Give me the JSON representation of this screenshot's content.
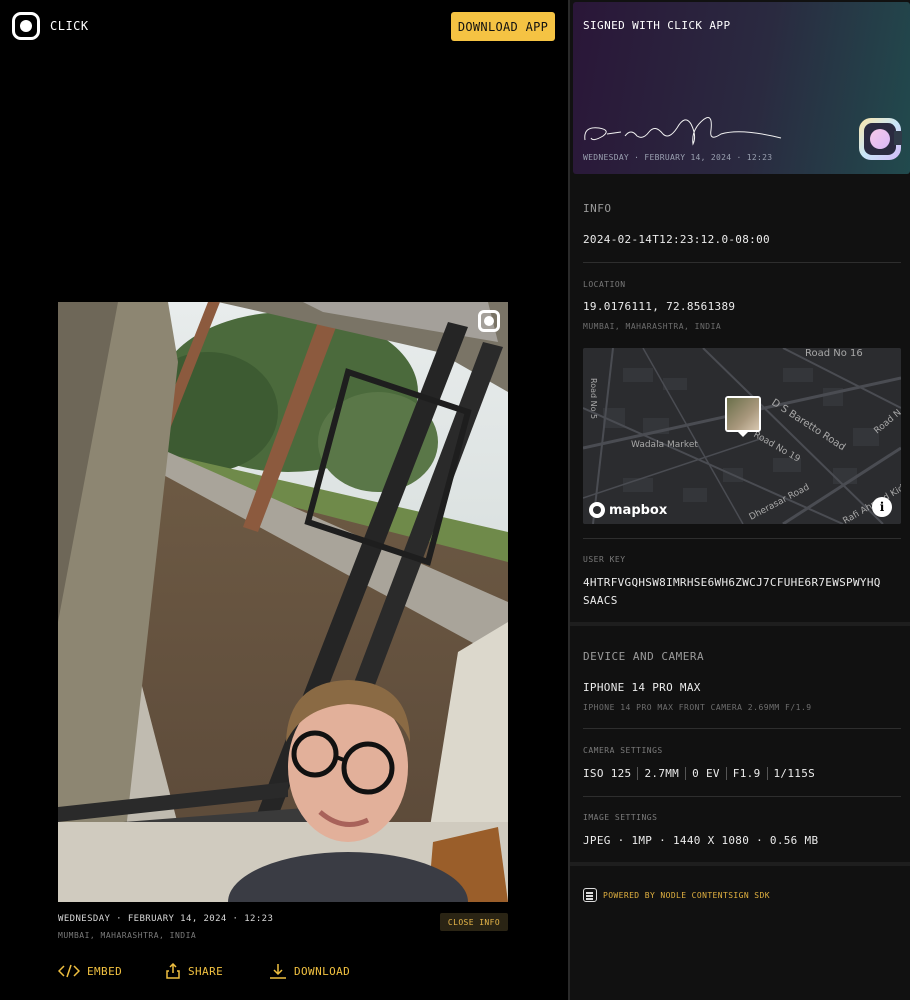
{
  "header": {
    "brand": "CLICK",
    "download_app": "DOWNLOAD APP"
  },
  "photo": {
    "date": "WEDNESDAY · FEBRUARY 14, 2024 · 12:23",
    "location": "MUMBAI, MAHARASHTRA, INDIA",
    "close_info": "CLOSE INFO"
  },
  "actions": {
    "embed": "EMBED",
    "share": "SHARE",
    "download": "DOWNLOAD"
  },
  "signature_card": {
    "title": "SIGNED WITH CLICK APP",
    "date": "WEDNESDAY · FEBRUARY 14, 2024 · 12:23"
  },
  "info": {
    "title": "INFO",
    "timestamp": "2024-02-14T12:23:12.0-08:00",
    "location_label": "LOCATION",
    "coordinates": "19.0176111, 72.8561389",
    "place": "MUMBAI, MAHARASHTRA, INDIA",
    "map": {
      "labels": {
        "road16": "Road No 16",
        "ds_baretto": "D S Baretto Road",
        "road19": "Road No 19",
        "wadala": "Wadala Market",
        "dherasar": "Dherasar Road",
        "kidwai": "Rafi Ahmed Kidwai Mar",
        "road_n": "Road N",
        "road_left": "Road No 5"
      },
      "attribution": "mapbox",
      "info_glyph": "i"
    },
    "user_key_label": "USER KEY",
    "user_key_line1": "4HTRFVGQHSW8IMRHSE6WH6ZWCJ7CFUHE6R7EWSPWYHQ",
    "user_key_line2": "SAACS"
  },
  "device": {
    "title": "DEVICE AND CAMERA",
    "model": "IPHONE 14 PRO MAX",
    "camera": "IPHONE 14 PRO MAX FRONT CAMERA 2.69MM F/1.9",
    "camera_settings_label": "CAMERA SETTINGS",
    "settings": [
      "ISO 125",
      "2.7MM",
      "0 EV",
      "F1.9",
      "1/115S"
    ],
    "image_settings_label": "IMAGE SETTINGS",
    "image_settings": "JPEG · 1MP · 1440 X 1080 · 0.56 MB"
  },
  "footer": {
    "powered": "POWERED BY NODLE CONTENTSIGN SDK"
  },
  "colors": {
    "accent": "#f5c343",
    "background": "#000000",
    "panel": "#111111"
  }
}
